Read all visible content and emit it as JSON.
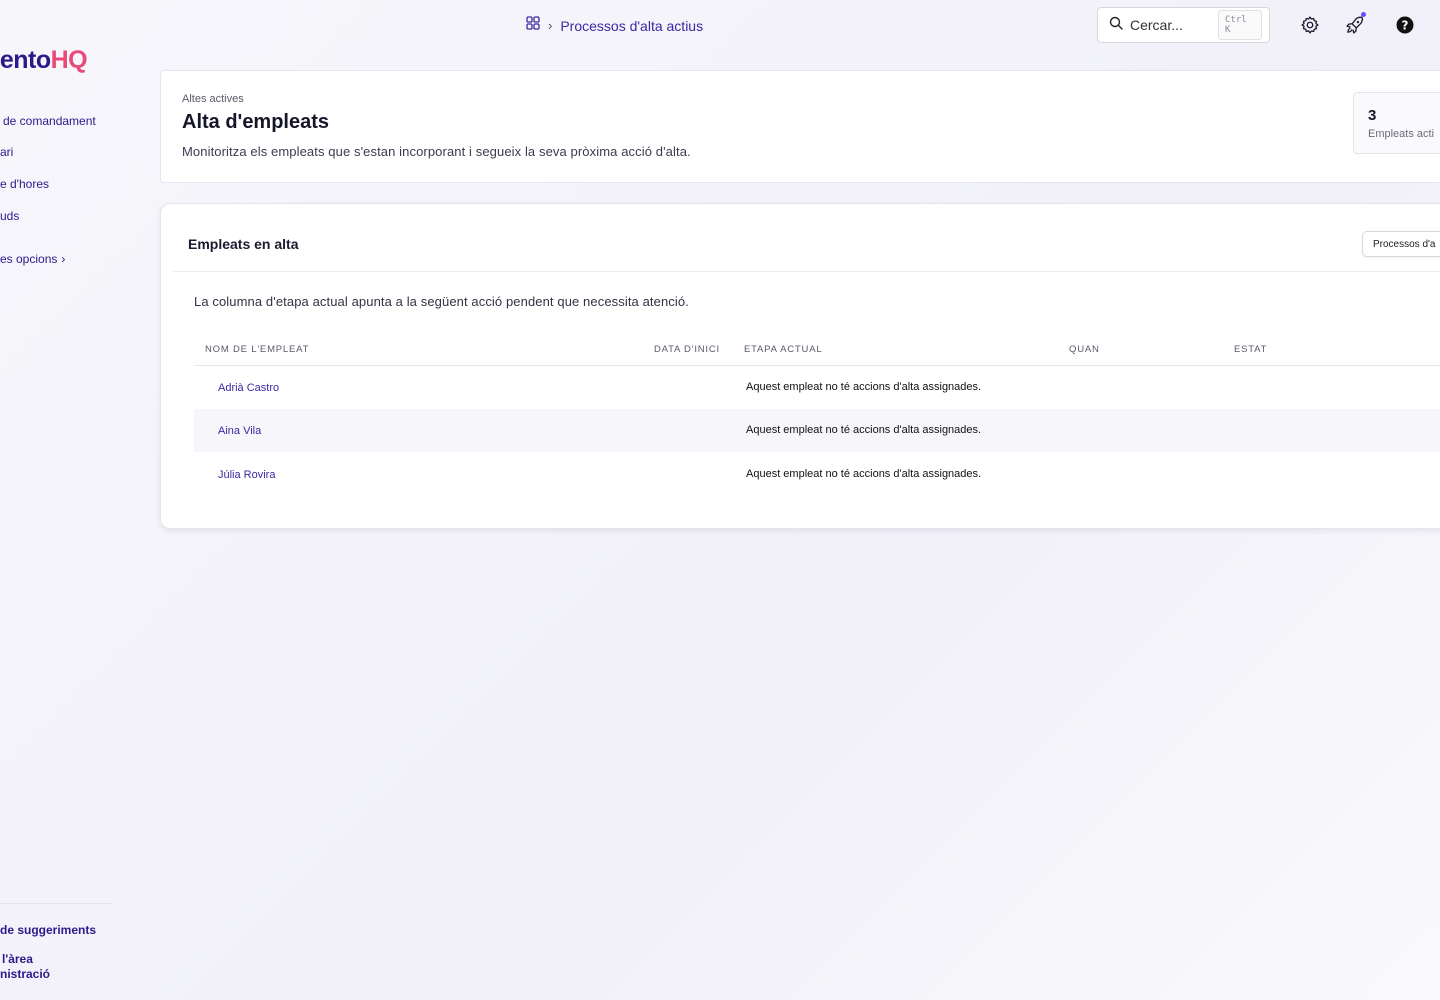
{
  "brand": {
    "logo_part1": "alento",
    "logo_part2": "HQ"
  },
  "sidebar": {
    "items": [
      {
        "label": "de comandament"
      },
      {
        "label": "ari"
      },
      {
        "label": "e d'hores"
      },
      {
        "label": "uds"
      },
      {
        "label": "es opcions"
      }
    ],
    "bottom": {
      "suggestions": "de suggeriments",
      "admin_line1": "l'àrea",
      "admin_line2": "nistració"
    }
  },
  "topbar": {
    "breadcrumb": "Processos d'alta actius",
    "search_placeholder": "Cercar...",
    "search_shortcut": "Ctrl K"
  },
  "header": {
    "eyebrow": "Altes actives",
    "title": "Alta d'empleats",
    "subtitle": "Monitoritza els empleats que s'estan incorporant i segueix la seva pròxima acció d'alta.",
    "stat_value": "3",
    "stat_label": "Empleats acti"
  },
  "card": {
    "title": "Empleats en alta",
    "button_label": "Processos d'a",
    "description": "La columna d'etapa actual apunta a la següent acció pendent que necessita atenció."
  },
  "table": {
    "columns": [
      "NOM DE L'EMPLEAT",
      "DATA D'INICI",
      "ETAPA ACTUAL",
      "QUAN",
      "ESTAT"
    ],
    "rows": [
      {
        "name": "Adrià Castro",
        "stage": "Aquest empleat no té accions d'alta assignades."
      },
      {
        "name": "Aina Vila",
        "stage": "Aquest empleat no té accions d'alta assignades."
      },
      {
        "name": "Júlia Rovira",
        "stage": "Aquest empleat no té accions d'alta assignades."
      }
    ]
  },
  "colors": {
    "accent": "#3a2aa0",
    "brand_pink": "#e84b7a",
    "notification": "#6b4dff"
  }
}
